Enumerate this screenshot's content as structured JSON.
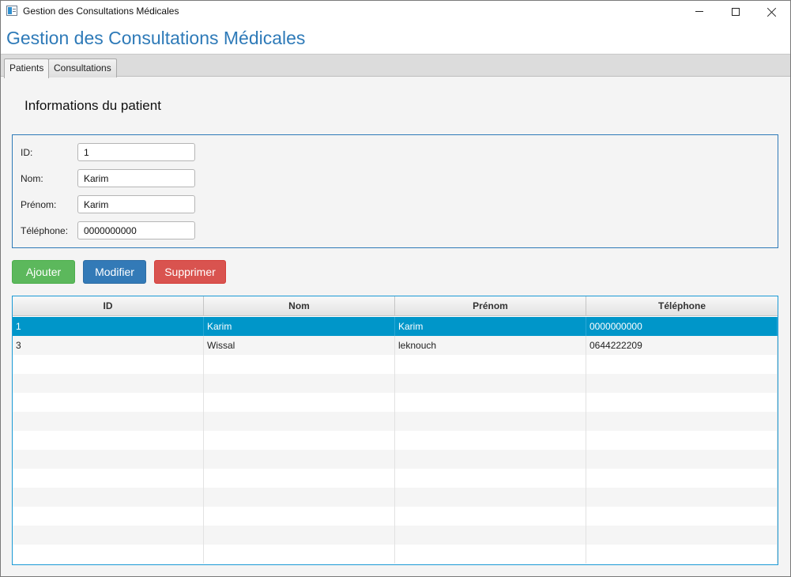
{
  "window": {
    "title": "Gestion des Consultations Médicales",
    "icon": "app-window-icon"
  },
  "header": {
    "title": "Gestion des Consultations Médicales"
  },
  "tabs": [
    {
      "label": "Patients",
      "active": true
    },
    {
      "label": "Consultations",
      "active": false
    }
  ],
  "form": {
    "section_title": "Informations du patient",
    "fields": [
      {
        "label": "ID:",
        "value": "1"
      },
      {
        "label": "Nom:",
        "value": "Karim"
      },
      {
        "label": "Prénom:",
        "value": "Karim"
      },
      {
        "label": "Téléphone:",
        "value": "0000000000"
      }
    ]
  },
  "buttons": {
    "add": "Ajouter",
    "edit": "Modifier",
    "delete": "Supprimer"
  },
  "table": {
    "columns": [
      "ID",
      "Nom",
      "Prénom",
      "Téléphone"
    ],
    "rows": [
      {
        "id": "1",
        "nom": "Karim",
        "prenom": "Karim",
        "telephone": "0000000000",
        "selected": true
      },
      {
        "id": "3",
        "nom": "Wissal",
        "prenom": "leknouch",
        "telephone": "0644222209",
        "selected": false
      }
    ],
    "empty_rows": 11
  },
  "colors": {
    "accent": "#2e7ab8",
    "add_button": "#5cb85c",
    "edit_button": "#337ab7",
    "delete_button": "#d9534f",
    "selection": "#0096c9"
  }
}
